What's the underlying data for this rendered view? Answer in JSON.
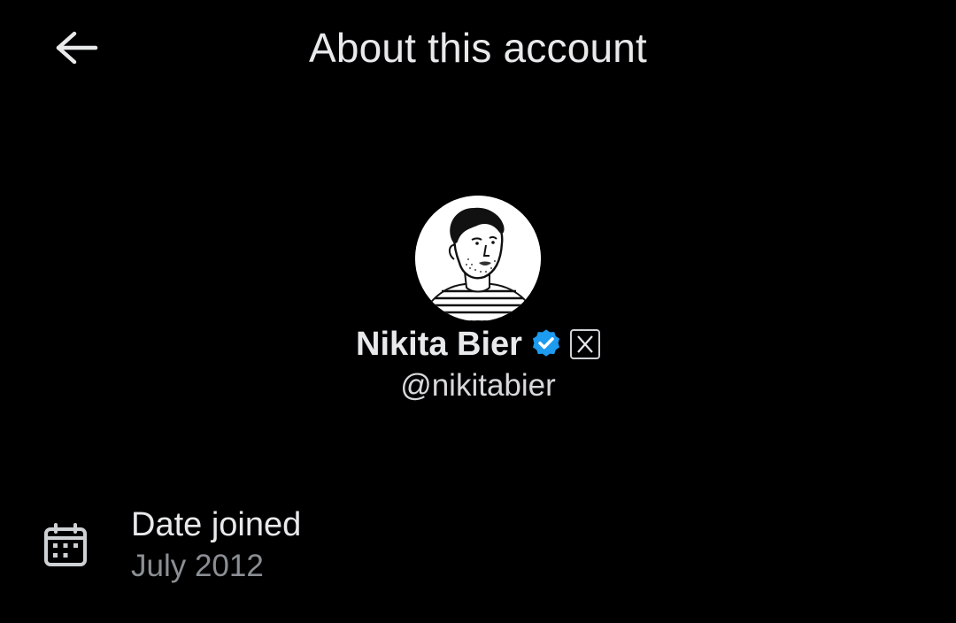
{
  "header": {
    "title": "About this account",
    "back_icon": "arrow-left-icon"
  },
  "profile": {
    "display_name": "Nikita Bier",
    "handle": "@nikitabier",
    "verified": true,
    "verified_color": "#1d9bf0",
    "affiliate_badge_icon": "x-logo-icon",
    "avatar_icon": "profile-avatar-sketch"
  },
  "details": [
    {
      "icon": "calendar-icon",
      "label": "Date joined",
      "value": "July 2012"
    }
  ],
  "colors": {
    "background": "#000000",
    "primary_text": "#e7e9ea",
    "secondary_text": "#8b8f94"
  }
}
